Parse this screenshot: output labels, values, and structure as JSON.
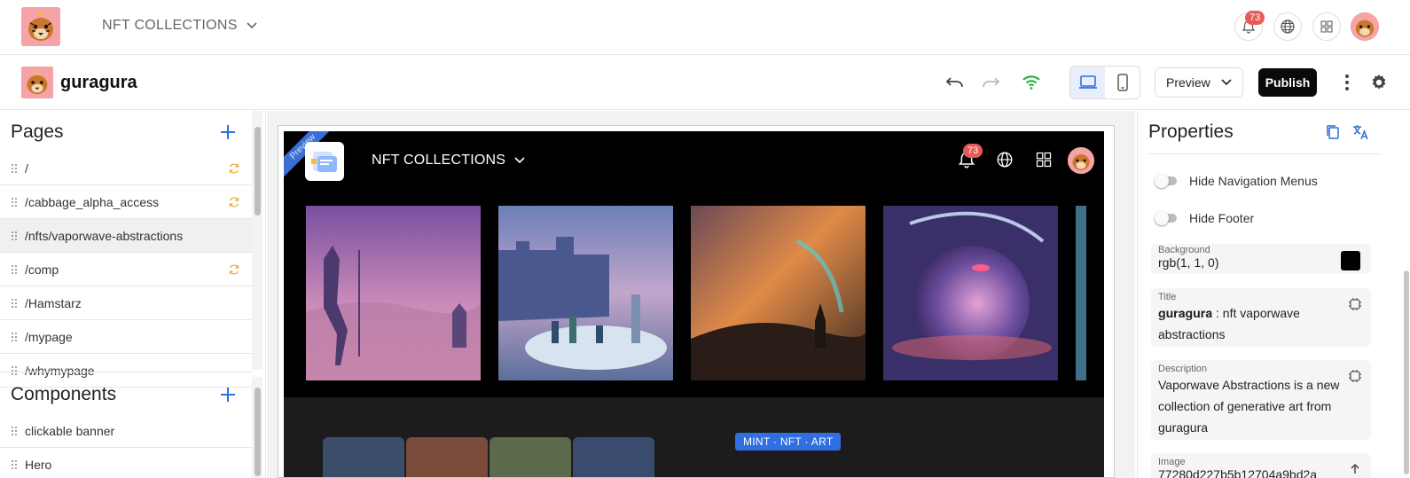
{
  "topbar": {
    "collection_label": "NFT COLLECTIONS",
    "notification_count": "73"
  },
  "toolbar": {
    "site_name": "guragura",
    "preview_label": "Preview",
    "publish_label": "Publish"
  },
  "pages": {
    "heading": "Pages",
    "items": [
      {
        "label": "/",
        "synced": true
      },
      {
        "label": "/cabbage_alpha_access",
        "synced": true
      },
      {
        "label": "/nfts/vaporwave-abstractions",
        "synced": false,
        "selected": true
      },
      {
        "label": "/comp",
        "synced": true
      },
      {
        "label": "/Hamstarz",
        "synced": false
      },
      {
        "label": "/mypage",
        "synced": false
      },
      {
        "label": "/whymypage",
        "synced": false
      }
    ]
  },
  "components": {
    "heading": "Components",
    "items": [
      {
        "label": "clickable banner"
      },
      {
        "label": "Hero"
      }
    ]
  },
  "canvas": {
    "ribbon": "Preview",
    "collection_label": "NFT COLLECTIONS",
    "notification_count": "73",
    "tag": "MINT · NFT · ART"
  },
  "properties": {
    "heading": "Properties",
    "hide_nav_label": "Hide Navigation Menus",
    "hide_footer_label": "Hide Footer",
    "background_label": "Background",
    "background_value": "rgb(1, 1, 0)",
    "background_color": "#010100",
    "title_label": "Title",
    "title_brand": "𝐠𝐮𝐫𝐚𝐠𝐮𝐫𝐚",
    "title_value": " : nft vaporwave abstractions",
    "description_label": "Description",
    "description_value": "Vaporwave Abstractions is a new collection of generative art from guragura",
    "image_label": "Image",
    "image_value": "77280d227b5b12704a9bd2a"
  },
  "colors": {
    "accent": "#2f6fe0",
    "publish": "#0a0a0a",
    "badge": "#e85a5a",
    "sync": "#e8b04a",
    "wifi": "#2bb24c"
  }
}
